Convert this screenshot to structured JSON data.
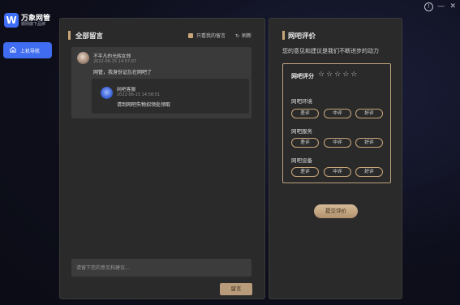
{
  "app": {
    "logo_glyph": "W",
    "name": "万象网管",
    "tagline": "顺网旗下品牌"
  },
  "window": {
    "info_glyph": "!",
    "minimize_glyph": "—",
    "close_glyph": "✕"
  },
  "sidebar": {
    "nav_item": "上机导航",
    "accent_color": "#3f6cf0"
  },
  "messages": {
    "title": "全部留言",
    "filter_label": "只看我的留言",
    "refresh_label": "刷新",
    "items": [
      {
        "name": "不平凡的光辉女郎",
        "time": "2022-06-15 14:57:07",
        "text": "网管，我身份证忘在网吧了",
        "reply": {
          "name": "网吧客服",
          "time": "2022-06-15 14:58:51",
          "text": "请到网吧失物招领处领取"
        }
      }
    ],
    "input_placeholder": "请留下您的意见和建议...",
    "post_label": "留言"
  },
  "review": {
    "title": "网吧评价",
    "subtitle": "您的意见和建议是我们不断进步的动力",
    "overall_label": "网吧评分",
    "stars": {
      "filled": 0,
      "total": 5,
      "glyphs": "☆☆☆☆☆"
    },
    "categories": [
      {
        "name": "网吧环境",
        "options": [
          "差评",
          "中评",
          "好评"
        ]
      },
      {
        "name": "网吧服务",
        "options": [
          "差评",
          "中评",
          "好评"
        ]
      },
      {
        "name": "网吧设备",
        "options": [
          "差评",
          "中评",
          "好评"
        ]
      }
    ],
    "submit_label": "提交评价",
    "accent_color": "#c9a67a"
  }
}
